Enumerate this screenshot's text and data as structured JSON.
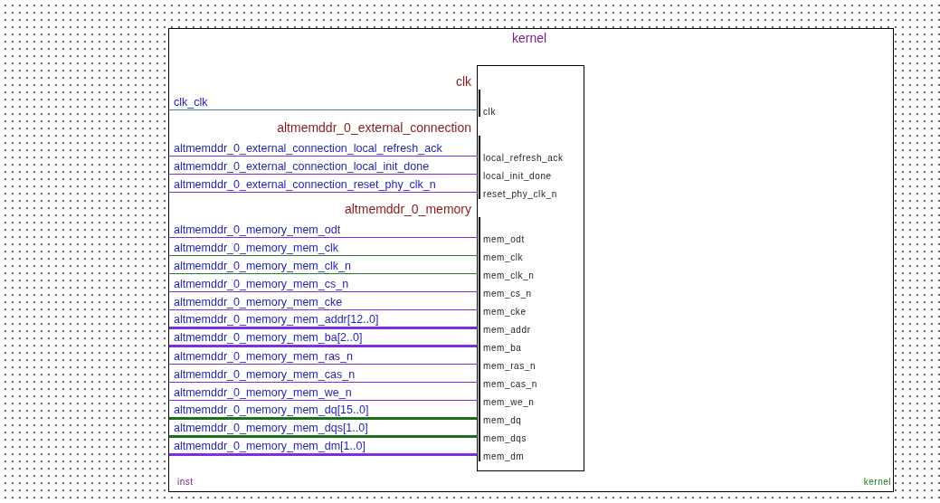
{
  "symbol": {
    "title": "kernel",
    "instance": "inst",
    "entity": "kernel",
    "groups": [
      {
        "name": "clk",
        "pins": [
          {
            "signal": "clk_clk",
            "port": "clk",
            "color": "#3b7fc4",
            "bus": false
          }
        ]
      },
      {
        "name": "altmemddr_0_external_connection",
        "pins": [
          {
            "signal": "altmemddr_0_external_connection_local_refresh_ack",
            "port": "local_refresh_ack",
            "color": "#8a2be2",
            "bus": false
          },
          {
            "signal": "altmemddr_0_external_connection_local_init_done",
            "port": "local_init_done",
            "color": "#8a2be2",
            "bus": false
          },
          {
            "signal": "altmemddr_0_external_connection_reset_phy_clk_n",
            "port": "reset_phy_clk_n",
            "color": "#8a2be2",
            "bus": false
          }
        ]
      },
      {
        "name": "altmemddr_0_memory",
        "pins": [
          {
            "signal": "altmemddr_0_memory_mem_odt",
            "port": "mem_odt",
            "color": "#8a2be2",
            "bus": false
          },
          {
            "signal": "altmemddr_0_memory_mem_clk",
            "port": "mem_clk",
            "color": "#2e7d32",
            "bus": false
          },
          {
            "signal": "altmemddr_0_memory_mem_clk_n",
            "port": "mem_clk_n",
            "color": "#2e7d32",
            "bus": false
          },
          {
            "signal": "altmemddr_0_memory_mem_cs_n",
            "port": "mem_cs_n",
            "color": "#8a2be2",
            "bus": false
          },
          {
            "signal": "altmemddr_0_memory_mem_cke",
            "port": "mem_cke",
            "color": "#8a2be2",
            "bus": false
          },
          {
            "signal": "altmemddr_0_memory_mem_addr[12..0]",
            "port": "mem_addr",
            "color": "#7b2fe0",
            "bus": true
          },
          {
            "signal": "altmemddr_0_memory_mem_ba[2..0]",
            "port": "mem_ba",
            "color": "#7b2fe0",
            "bus": true
          },
          {
            "signal": "altmemddr_0_memory_mem_ras_n",
            "port": "mem_ras_n",
            "color": "#8a2be2",
            "bus": false
          },
          {
            "signal": "altmemddr_0_memory_mem_cas_n",
            "port": "mem_cas_n",
            "color": "#8a2be2",
            "bus": false
          },
          {
            "signal": "altmemddr_0_memory_mem_we_n",
            "port": "mem_we_n",
            "color": "#8a2be2",
            "bus": false
          },
          {
            "signal": "altmemddr_0_memory_mem_dq[15..0]",
            "port": "mem_dq",
            "color": "#1b6e1b",
            "bus": true
          },
          {
            "signal": "altmemddr_0_memory_mem_dqs[1..0]",
            "port": "mem_dqs",
            "color": "#1b6e1b",
            "bus": true
          },
          {
            "signal": "altmemddr_0_memory_mem_dm[1..0]",
            "port": "mem_dm",
            "color": "#7b2fe0",
            "bus": true
          }
        ]
      }
    ]
  }
}
